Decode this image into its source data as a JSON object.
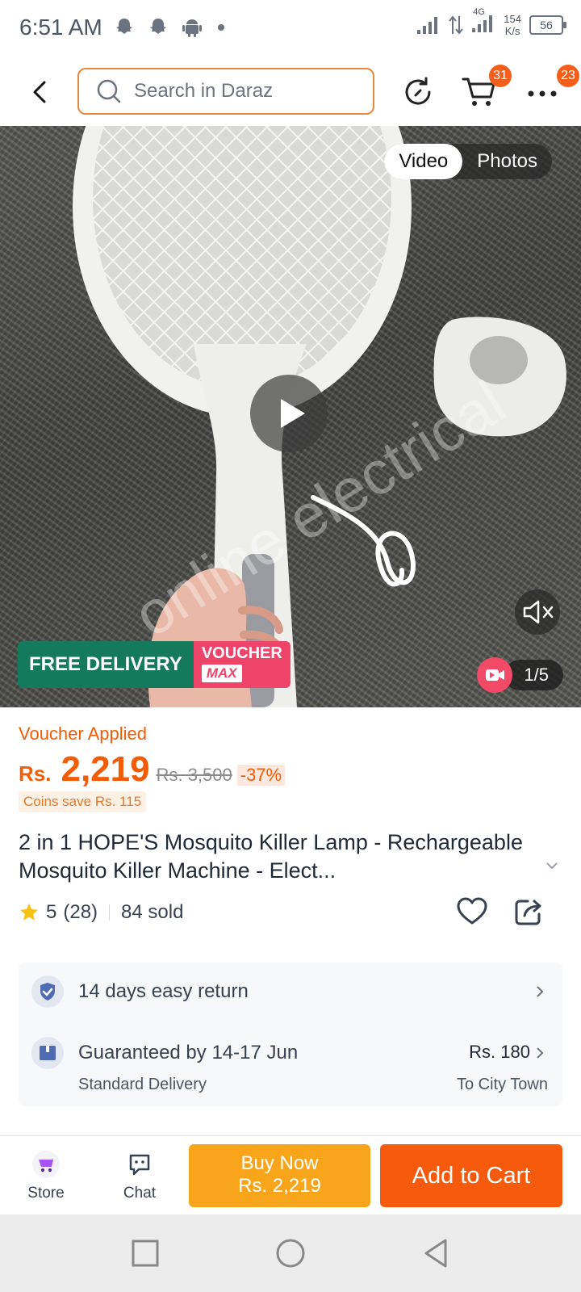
{
  "status": {
    "time": "6:51 AM",
    "net_type": "4G",
    "speed_value": "154",
    "speed_unit": "K/s",
    "battery": "56"
  },
  "nav": {
    "search_placeholder": "Search in Daraz",
    "cart_badge": "31",
    "more_badge": "23"
  },
  "media": {
    "tabs": [
      "Video",
      "Photos"
    ],
    "active_tab": "Video",
    "counter": "1/5",
    "promo_free": "FREE DELIVERY",
    "promo_voucher": "VOUCHER",
    "promo_max": "MAX"
  },
  "product": {
    "voucher_applied": "Voucher Applied",
    "currency": "Rs.",
    "price": "2,219",
    "old_price": "Rs. 3,500",
    "discount": "-37%",
    "coins": "Coins save Rs. 115",
    "title": "2 in 1 HOPE'S Mosquito Killer Lamp - Rechargeable Mosquito Killer Machine - Elect...",
    "rating": "5",
    "rating_count": "(28)",
    "sold": "84 sold"
  },
  "services": {
    "return": "14 days easy return",
    "guarantee": "Guaranteed by 14-17 Jun",
    "delivery_type": "Standard Delivery",
    "delivery_fee": "Rs. 180",
    "destination": "To City Town"
  },
  "actions": {
    "store": "Store",
    "chat": "Chat",
    "buy_now": "Buy Now",
    "buy_price": "Rs. 2,219",
    "add_to_cart": "Add to Cart"
  },
  "colors": {
    "accent": "#f25c05",
    "buy_now": "#f9a51b",
    "add_to_cart": "#f55a0d",
    "free_delivery": "#157a5c",
    "voucher": "#ef4469"
  }
}
